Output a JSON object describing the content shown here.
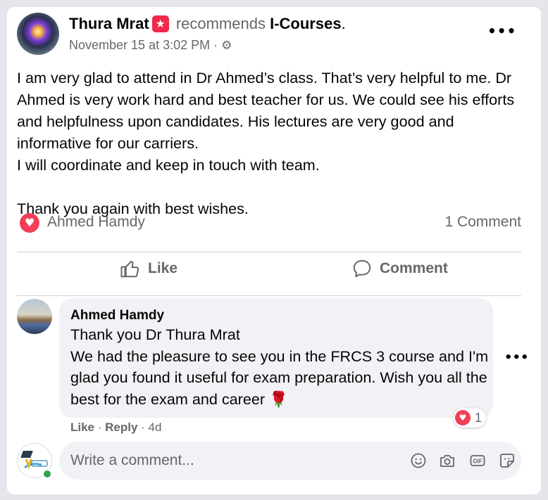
{
  "post": {
    "author": "Thura Mrat",
    "verb": "recommends",
    "page": "I-Courses",
    "page_suffix": ".",
    "timestamp": "November 15 at 3:02 PM",
    "meta_sep": " · ",
    "privacy_icon": "gear-icon",
    "more_icon": "more-options-icon",
    "text": "I am very glad to attend in Dr Ahmed’s class. That’s very helpful to me. Dr Ahmed is very work hard and best teacher for us. We could see his efforts and helpfulness upon candidates. His lectures are very good and informative for our carriers.\nI will coordinate and keep in touch with team.\n\nThank you again with best wishes."
  },
  "reactions": {
    "icon": "love-reaction-icon",
    "reactor": "Ahmed Hamdy",
    "comment_count": "1 Comment"
  },
  "actions": {
    "like_label": "Like",
    "comment_label": "Comment"
  },
  "comment": {
    "author": "Ahmed Hamdy",
    "text": "Thank you Dr Thura Mrat\nWe had the pleasure to see you in the FRCS 3 course and I'm glad you found it useful for exam preparation. Wish you all the best for the exam and career",
    "emoji": "🌹",
    "reaction_count": "1",
    "like_label": "Like",
    "sep": " · ",
    "reply_label": "Reply",
    "age": "4d"
  },
  "composer": {
    "placeholder": "Write a comment...",
    "icons": [
      "emoji-icon",
      "camera-icon",
      "gif-icon",
      "sticker-icon"
    ]
  },
  "colors": {
    "accent_red": "#f02849",
    "love": "#f33e58",
    "secondary_text": "#65676b",
    "online": "#31a24c"
  }
}
